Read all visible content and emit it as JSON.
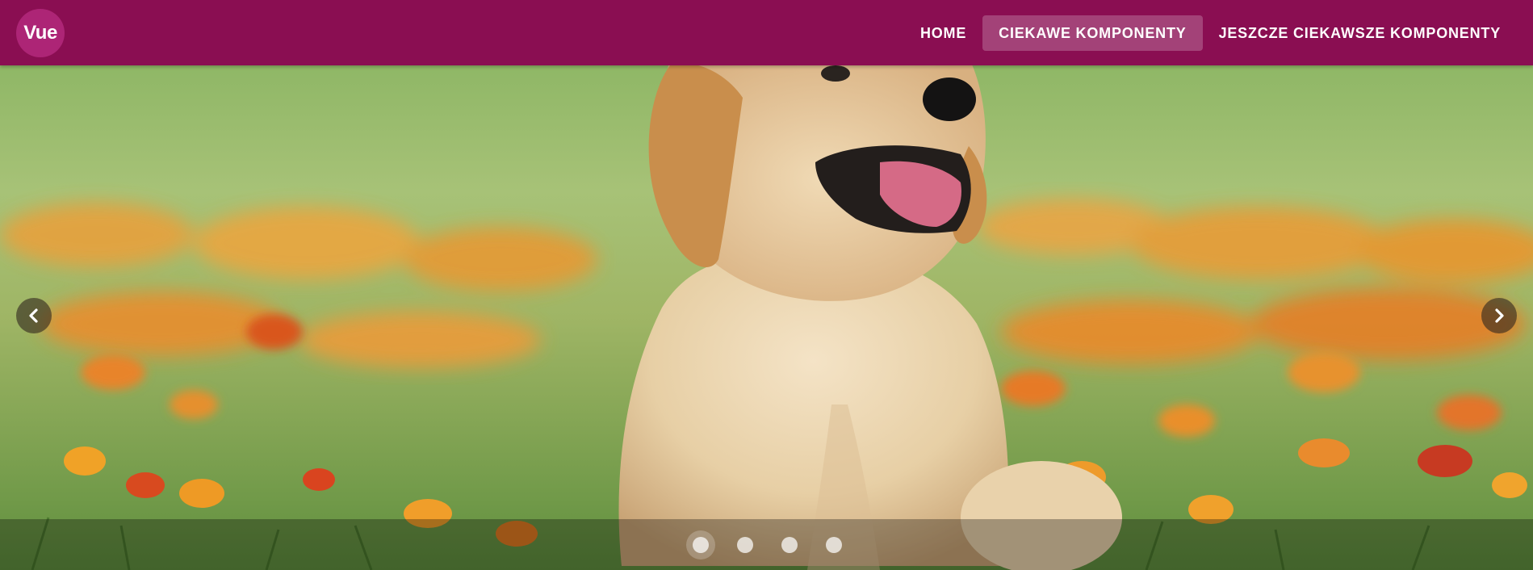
{
  "app_bar": {
    "logo_text": "Vue",
    "color": "#8a0e52",
    "nav": [
      {
        "label": "HOME",
        "active": false
      },
      {
        "label": "CIEKAWE KOMPONENTY",
        "active": true
      },
      {
        "label": "JESZCZE CIEKAWSZE KOMPONENTY",
        "active": false
      }
    ]
  },
  "carousel": {
    "icons": {
      "prev": "chevron-left-icon",
      "next": "chevron-right-icon"
    },
    "slide_count": 4,
    "active_slide": 1
  }
}
